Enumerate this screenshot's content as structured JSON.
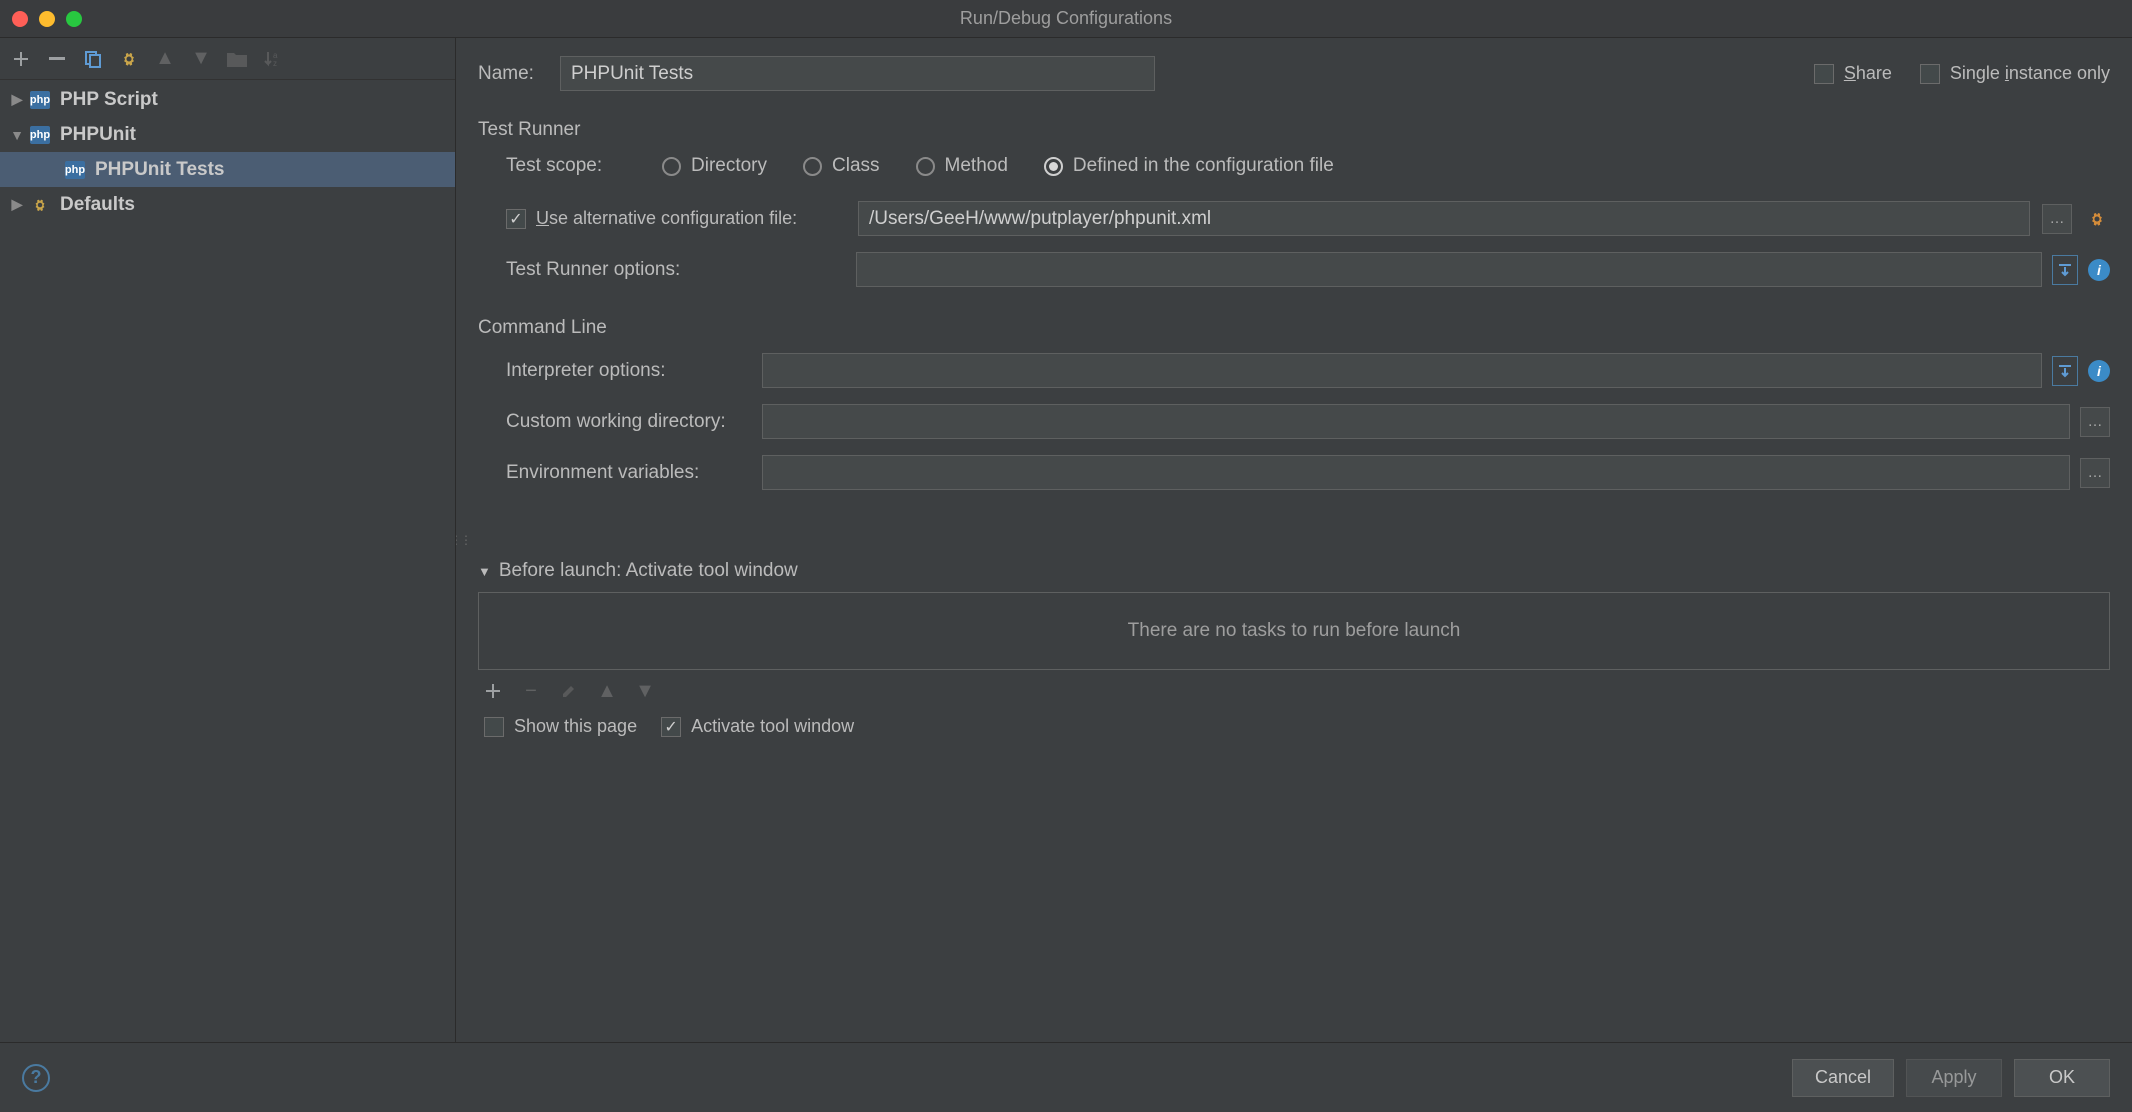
{
  "titlebar": {
    "title": "Run/Debug Configurations"
  },
  "sidebar": {
    "items": [
      {
        "label": "PHP Script",
        "expanded": false,
        "hasChildren": true,
        "icon": "php"
      },
      {
        "label": "PHPUnit",
        "expanded": true,
        "hasChildren": true,
        "icon": "php",
        "children": [
          {
            "label": "PHPUnit Tests",
            "selected": true,
            "icon": "php"
          }
        ]
      },
      {
        "label": "Defaults",
        "expanded": false,
        "hasChildren": true,
        "icon": "gear"
      }
    ]
  },
  "form": {
    "nameLabel": "Name:",
    "nameValue": "PHPUnit Tests",
    "shareLabel": "Share",
    "shareChecked": false,
    "singleInstanceLabel": "Single instance only",
    "singleInstanceChecked": false,
    "testRunner": {
      "title": "Test Runner",
      "scopeLabel": "Test scope:",
      "scopes": [
        "Directory",
        "Class",
        "Method",
        "Defined in the configuration file"
      ],
      "scopeSelected": "Defined in the configuration file",
      "useAltConfigLabel": "Use alternative configuration file:",
      "useAltConfigChecked": true,
      "altConfigPath": "/Users/GeeH/www/putplayer/phpunit.xml",
      "runnerOptionsLabel": "Test Runner options:",
      "runnerOptionsValue": ""
    },
    "commandLine": {
      "title": "Command Line",
      "interpreterLabel": "Interpreter options:",
      "interpreterValue": "",
      "cwdLabel": "Custom working directory:",
      "cwdValue": "",
      "envLabel": "Environment variables:",
      "envValue": ""
    },
    "beforeLaunch": {
      "header": "Before launch: Activate tool window",
      "emptyText": "There are no tasks to run before launch",
      "showPageLabel": "Show this page",
      "showPageChecked": false,
      "activateToolLabel": "Activate tool window",
      "activateToolChecked": true
    }
  },
  "footer": {
    "cancel": "Cancel",
    "apply": "Apply",
    "ok": "OK"
  }
}
